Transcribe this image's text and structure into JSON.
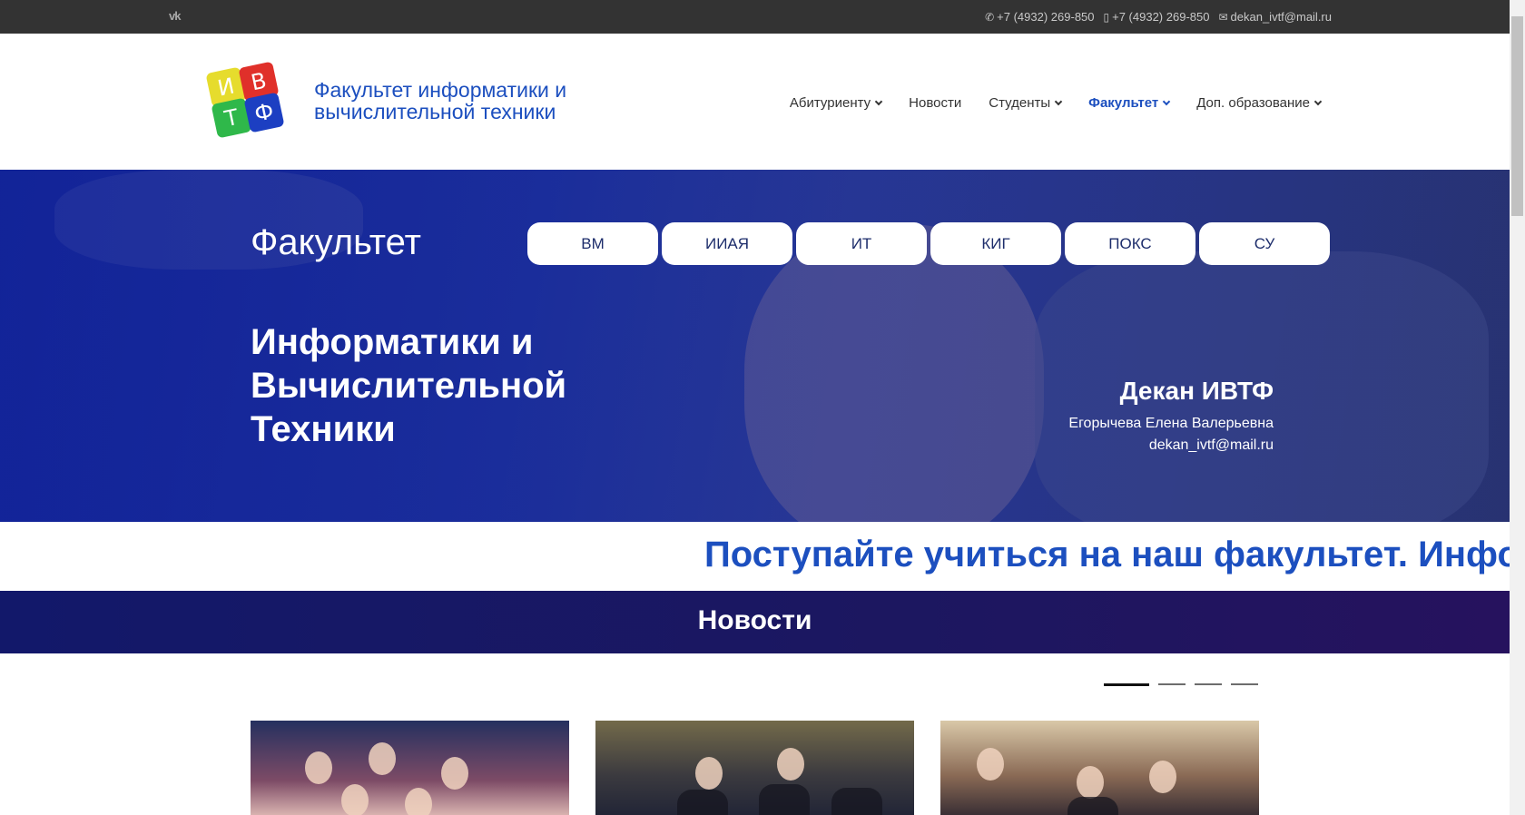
{
  "topbar": {
    "vk_label": "vk",
    "phone1": "+7 (4932) 269-850",
    "phone2": "+7 (4932) 269-850",
    "email": "dekan_ivtf@mail.ru"
  },
  "header": {
    "logo_letters": [
      "И",
      "В",
      "Т",
      "Ф"
    ],
    "site_name": "Факультет информатики и вычислительной техники",
    "nav": [
      {
        "label": "Абитуриенту",
        "dropdown": true
      },
      {
        "label": "Новости",
        "dropdown": false
      },
      {
        "label": "Студенты",
        "dropdown": true
      },
      {
        "label": "Факультет",
        "dropdown": true,
        "active": true
      },
      {
        "label": "Доп. образование",
        "dropdown": true
      }
    ]
  },
  "hero": {
    "faculty_label": "Факультет",
    "departments": [
      "ВМ",
      "ИИАЯ",
      "ИТ",
      "КИГ",
      "ПОКС",
      "СУ"
    ],
    "title": "Информатики и Вычислительной Техники",
    "dean_title": "Декан ИВТФ",
    "dean_name": "Егорычева Елена Валерьевна",
    "dean_email": "dekan_ivtf@mail.ru"
  },
  "marquee": {
    "text": "Поступайте учиться на наш факультет. Информ"
  },
  "news": {
    "heading": "Новости",
    "slides_total": 4,
    "active_slide": 1
  },
  "colors": {
    "brand_blue": "#1c4fbf",
    "topbar": "#333333",
    "news_band": "#1c1760"
  }
}
